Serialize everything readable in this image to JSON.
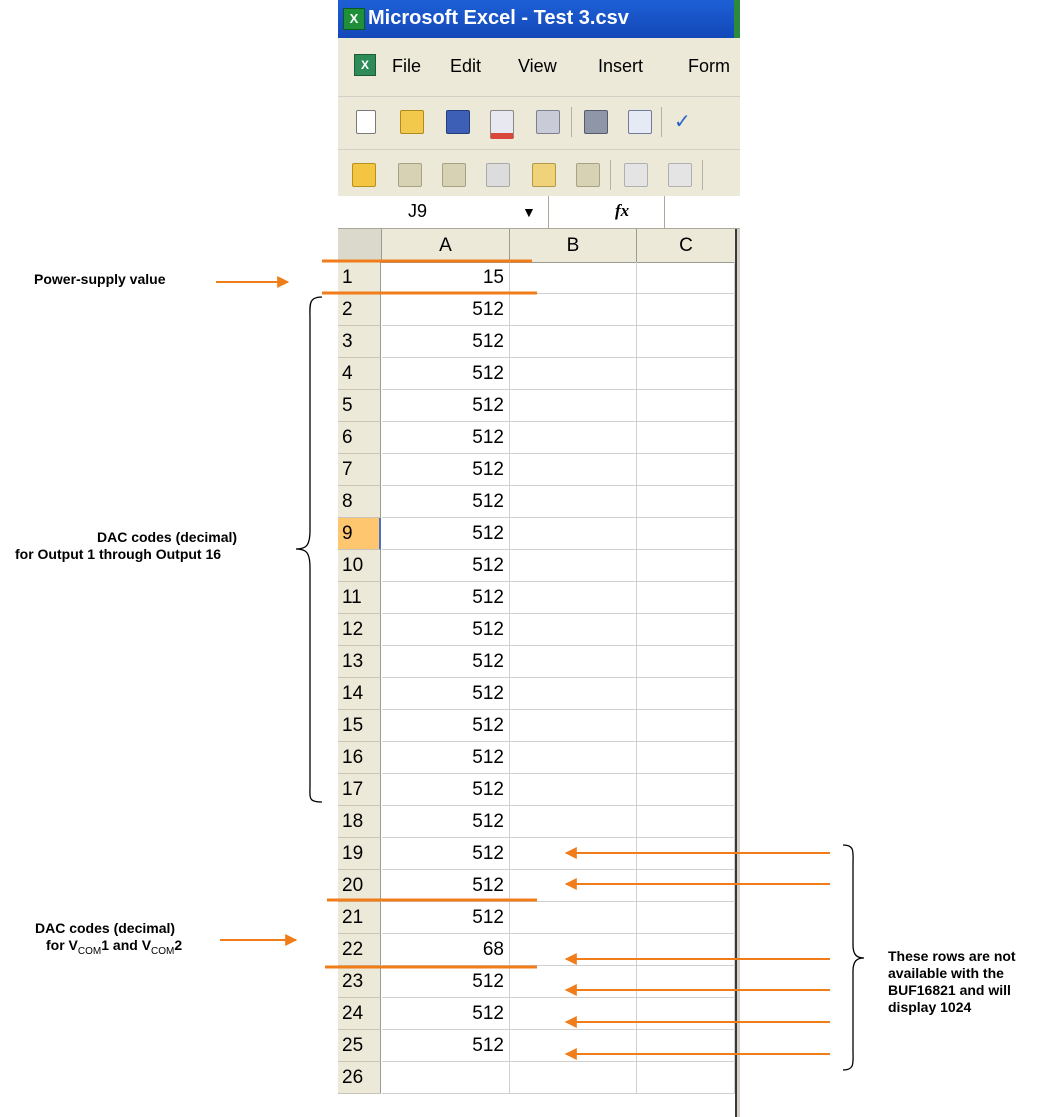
{
  "window": {
    "title": "Microsoft Excel - Test 3.csv",
    "app_icon": "excel-icon"
  },
  "menu": [
    "File",
    "Edit",
    "View",
    "Insert",
    "Form"
  ],
  "formula_bar": {
    "cell_ref": "J9",
    "fx": "fx",
    "value": ""
  },
  "columns": [
    "A",
    "B",
    "C"
  ],
  "rows": [
    {
      "n": "1",
      "a": "15"
    },
    {
      "n": "2",
      "a": "512"
    },
    {
      "n": "3",
      "a": "512"
    },
    {
      "n": "4",
      "a": "512"
    },
    {
      "n": "5",
      "a": "512"
    },
    {
      "n": "6",
      "a": "512"
    },
    {
      "n": "7",
      "a": "512"
    },
    {
      "n": "8",
      "a": "512"
    },
    {
      "n": "9",
      "a": "512"
    },
    {
      "n": "10",
      "a": "512"
    },
    {
      "n": "11",
      "a": "512"
    },
    {
      "n": "12",
      "a": "512"
    },
    {
      "n": "13",
      "a": "512"
    },
    {
      "n": "14",
      "a": "512"
    },
    {
      "n": "15",
      "a": "512"
    },
    {
      "n": "16",
      "a": "512"
    },
    {
      "n": "17",
      "a": "512"
    },
    {
      "n": "18",
      "a": "512"
    },
    {
      "n": "19",
      "a": "512"
    },
    {
      "n": "20",
      "a": "512"
    },
    {
      "n": "21",
      "a": "512"
    },
    {
      "n": "22",
      "a": "68"
    },
    {
      "n": "23",
      "a": "512"
    },
    {
      "n": "24",
      "a": "512"
    },
    {
      "n": "25",
      "a": "512"
    },
    {
      "n": "26",
      "a": ""
    }
  ],
  "selected_row": "9",
  "annotations": {
    "power": "Power-supply value",
    "dac_outputs_1": "DAC codes (decimal)",
    "dac_outputs_2": "for Output 1 through Output 16",
    "vcom_1": "DAC codes (decimal)",
    "vcom_2_pre": "for V",
    "vcom_sub": "COM",
    "vcom_2_mid": "1 and V",
    "vcom_2_post": "2",
    "unavailable_1": "These rows are not",
    "unavailable_2": "available with the",
    "unavailable_3": "BUF16821 and will",
    "unavailable_4": "display 1024"
  },
  "colors": {
    "annotation": "#f07c1a",
    "titlebar": "#1e5fd6",
    "chrome": "#ece9d8"
  }
}
